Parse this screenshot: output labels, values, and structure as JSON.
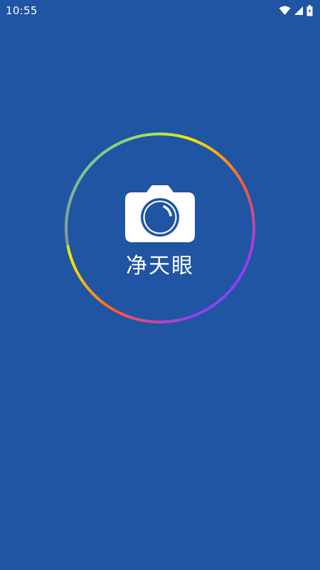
{
  "status_bar": {
    "time": "10:55",
    "icons": [
      "wifi-icon",
      "cellular-signal-icon",
      "battery-icon"
    ]
  },
  "splash": {
    "app_name": "净天眼",
    "logo_icon": "camera-icon",
    "ring_gradient": [
      "#00e5ff",
      "#f5e600",
      "#ff5a2d",
      "#9b3cf0",
      "#3f5bff"
    ]
  },
  "colors": {
    "background": "#1f55a3",
    "logo": "#ffffff"
  }
}
